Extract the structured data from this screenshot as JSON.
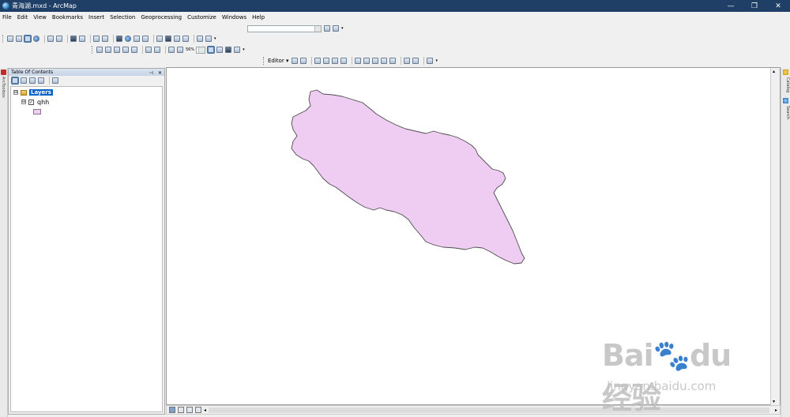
{
  "window": {
    "title": "青海湖.mxd - ArcMap",
    "controls": {
      "minimize": "—",
      "restore": "❐",
      "close": "✕"
    }
  },
  "menu": [
    "File",
    "Edit",
    "View",
    "Bookmarks",
    "Insert",
    "Selection",
    "Geoprocessing",
    "Customize",
    "Windows",
    "Help"
  ],
  "toolbar": {
    "scale_value": "",
    "zoom_percent": "56%",
    "editor_label": "Editor ▾"
  },
  "left_strip": {
    "label": "ArcToolbox"
  },
  "toc": {
    "title": "Table Of Contents",
    "pin_glyph": "⊣",
    "close_glyph": "✕",
    "data_frame": "Layers",
    "layer_name": "qhh",
    "layer_checked": "✓",
    "expander_glyph": "⊟"
  },
  "map": {
    "polygon_fill": "#efcdf3",
    "polygon_stroke": "#4d4d4d"
  },
  "right_strip": {
    "tabs": [
      "Catalog",
      "Search"
    ]
  },
  "scrollbar": {
    "left": "◂",
    "right": "▸",
    "up": "▴",
    "down": "▾"
  },
  "colors": {
    "titlebar": "#1f3f66",
    "selection": "#0a64c8"
  }
}
